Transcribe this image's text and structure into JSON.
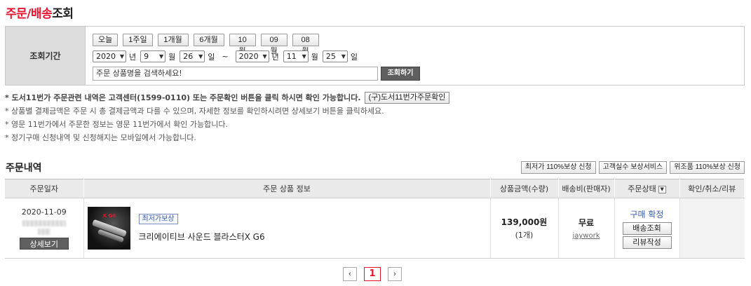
{
  "title": {
    "part1": "주문/배송",
    "part2": "조회"
  },
  "search": {
    "label": "조회기간",
    "period_buttons": [
      "오늘",
      "1주일",
      "1개월",
      "6개월",
      "10월",
      "09월",
      "08월"
    ],
    "from": {
      "year": "2020",
      "month": "9",
      "day": "26"
    },
    "to": {
      "year": "2020",
      "month": "11",
      "day": "25"
    },
    "units": {
      "year": "년",
      "month": "월",
      "day": "일"
    },
    "tilde": "~",
    "keyword_value": "주문 상품명을 검색하세요!",
    "search_button": "조회하기"
  },
  "notices": {
    "line1": "* 도서11번가 주문관련 내역은 고객센터(1599-0110) 또는 주문확인 버튼을 클릭 하시면 확인 가능합니다.",
    "line1_button": "(구)도서11번가주문확인",
    "line2": "* 상품별 결제금액은 주문 시 총 결제금액과 다를 수 있으며, 자세한 정보를 확인하시려면 상세보기 버튼을 클릭하세요.",
    "line3": "* 영문 11번가에서 주문한 정보는 영문 11번가에서 확인 가능합니다.",
    "line4": "* 정기구매 신청내역 및 신청해지는 모바일에서 가능합니다."
  },
  "orders": {
    "section_title": "주문내역",
    "top_buttons": [
      "최저가 110%보상 신청",
      "고객실수 보상서비스",
      "위조품 110%보상 신청"
    ],
    "columns": [
      "주문일자",
      "주문 상품 정보",
      "상품금액(수량)",
      "배송비(판매자)",
      "주문상태",
      "확인/취소/리뷰"
    ],
    "rows": [
      {
        "date": "2020-11-09",
        "detail_button": "상세보기",
        "badge": "최저가보상",
        "product_name": "크리에이티브 사운드 블라스터X G6",
        "thumb_label": "SoundBlasterX G6",
        "price": "139,000원",
        "qty": "(1개)",
        "ship_fee": "무료",
        "seller": "jaywork",
        "status": "구매 확정",
        "status_buttons": [
          "배송조회",
          "리뷰작성"
        ]
      }
    ]
  },
  "pager": {
    "prev": "‹",
    "current": "1",
    "next": "›"
  }
}
